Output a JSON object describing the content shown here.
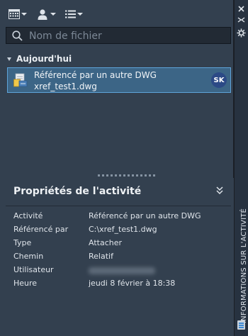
{
  "toolbar": {
    "view_icon": "calendar-grid-icon",
    "user_icon": "user-icon",
    "list_icon": "list-icon"
  },
  "search": {
    "placeholder": "Nom de fichier",
    "value": ""
  },
  "group": {
    "label": "Aujourd'hui"
  },
  "activity_row": {
    "line1": "Référencé par un autre DWG",
    "line2": "xref_test1.dwg",
    "avatar_initials": "SK",
    "icon": "xref-document-icon"
  },
  "properties": {
    "title": "Propriétés de l'activité",
    "rows": [
      {
        "key": "Activité",
        "value": "Référencé par un autre DWG"
      },
      {
        "key": "Référencé par",
        "value": "C:\\xref_test1.dwg"
      },
      {
        "key": "Type",
        "value": "Attacher"
      },
      {
        "key": "Chemin",
        "value": "Relatif"
      },
      {
        "key": "Utilisateur",
        "value": ""
      },
      {
        "key": "Heure",
        "value": "jeudi 8 février à 18:38"
      }
    ]
  },
  "side_panel": {
    "title": "INFORMATIONS SUR L'ACTIVITÉ",
    "close_icon": "close-icon",
    "pin_icon": "auto-hide-icon",
    "settings_icon": "settings-icon"
  },
  "colors": {
    "panel_bg": "#33404f",
    "selection_bg": "#3c6586",
    "selection_border": "#5ea3d8",
    "avatar_bg": "#2c4a86"
  }
}
